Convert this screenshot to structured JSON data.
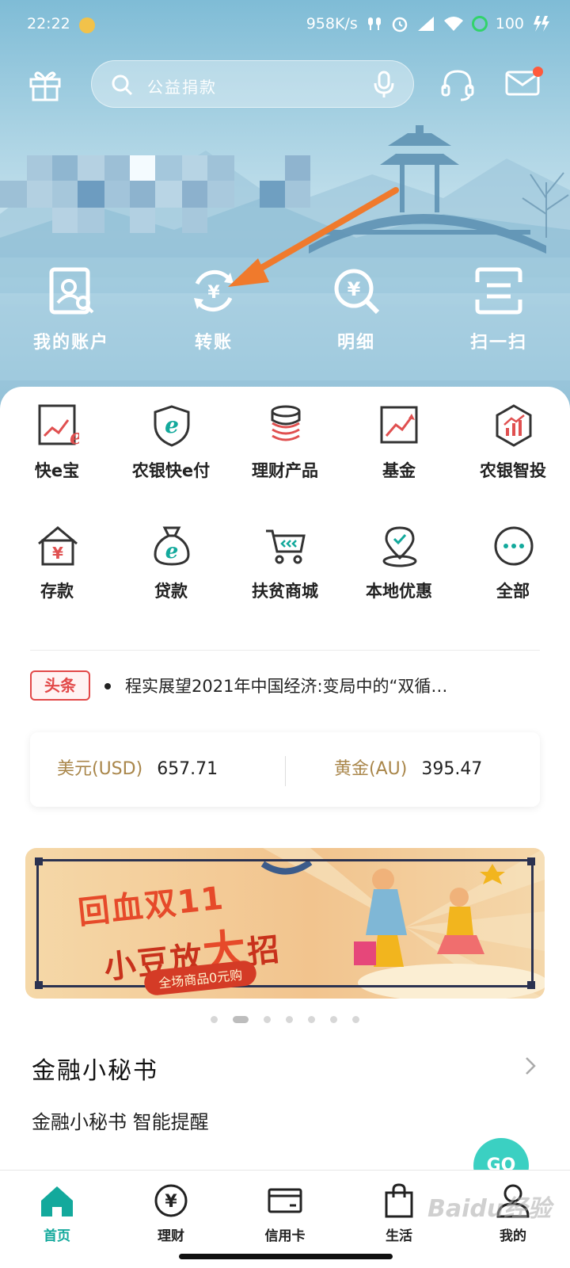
{
  "status_bar": {
    "time": "22:22",
    "network_speed": "958K/s",
    "battery": "100"
  },
  "search": {
    "placeholder": "公益捐款"
  },
  "quick_actions": [
    {
      "label": "我的账户",
      "icon": "account-icon"
    },
    {
      "label": "转账",
      "icon": "transfer-icon"
    },
    {
      "label": "明细",
      "icon": "details-icon"
    },
    {
      "label": "扫一扫",
      "icon": "scan-icon"
    }
  ],
  "services": [
    {
      "label": "快e宝",
      "icon": "kuai-e-bao-icon"
    },
    {
      "label": "农银快e付",
      "icon": "e-pay-shield-icon"
    },
    {
      "label": "理财产品",
      "icon": "coins-stack-icon"
    },
    {
      "label": "基金",
      "icon": "fund-chart-icon"
    },
    {
      "label": "农银智投",
      "icon": "smart-invest-icon"
    },
    {
      "label": "存款",
      "icon": "deposit-house-icon"
    },
    {
      "label": "贷款",
      "icon": "loan-bag-icon"
    },
    {
      "label": "扶贫商城",
      "icon": "shopping-cart-icon"
    },
    {
      "label": "本地优惠",
      "icon": "location-pin-icon"
    },
    {
      "label": "全部",
      "icon": "more-icon"
    }
  ],
  "headline": {
    "badge": "头条",
    "text": "程实展望2021年中国经济:变局中的“双循…"
  },
  "rates": {
    "usd": {
      "name": "美元(USD)",
      "value": "657.71"
    },
    "au": {
      "name": "黄金(AU)",
      "value": "395.47"
    }
  },
  "banner": {
    "line1": "回血双11",
    "line2_prefix": "小豆放",
    "line2_big": "大",
    "line2_suffix": "招",
    "pill": "全场商品0元购"
  },
  "carousel": {
    "count": 7,
    "active_index": 1
  },
  "finance_secretary": {
    "title": "金融小秘书",
    "subtitle": "金融小秘书 智能提醒"
  },
  "go_button": {
    "label": "GO"
  },
  "bottom_nav": [
    {
      "label": "首页",
      "icon": "home-icon",
      "active": true
    },
    {
      "label": "理财",
      "icon": "yuan-circle-icon",
      "active": false
    },
    {
      "label": "信用卡",
      "icon": "credit-card-icon",
      "active": false
    },
    {
      "label": "生活",
      "icon": "shopping-bag-icon",
      "active": false
    },
    {
      "label": "我的",
      "icon": "user-icon",
      "active": false
    }
  ],
  "watermark": "Baidu经验",
  "colors": {
    "brand_teal": "#13a99c",
    "headline_red": "#e24848",
    "rate_gold": "#a9864a",
    "arrow_orange": "#f07a2c"
  }
}
